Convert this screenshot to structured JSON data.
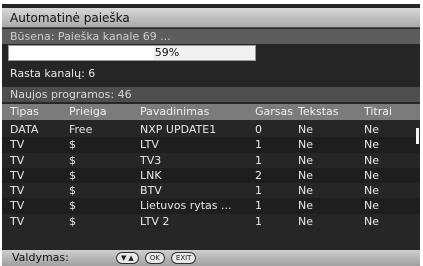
{
  "window": {
    "title": "Automatinė paieška"
  },
  "status": {
    "text": "Būsena: Paieška kanale 69 ..."
  },
  "progress": {
    "value": 0.59,
    "label": "59%"
  },
  "found": {
    "text": "Rasta kanalų: 6"
  },
  "new_programs": {
    "text": "Naujos programos: 46"
  },
  "table": {
    "columns": [
      "Tipas",
      "Prieiga",
      "Pavadinimas",
      "Garsas",
      "Tekstas",
      "Titrai"
    ],
    "rows": [
      [
        "DATA",
        "Free",
        "NXP UPDATE1",
        "0",
        "Ne",
        "Ne"
      ],
      [
        "TV",
        "$",
        "LTV",
        "1",
        "Ne",
        "Ne"
      ],
      [
        "TV",
        "$",
        "TV3",
        "1",
        "Ne",
        "Ne"
      ],
      [
        "TV",
        "$",
        "LNK",
        "2",
        "Ne",
        "Ne"
      ],
      [
        "TV",
        "$",
        "BTV",
        "1",
        "Ne",
        "Ne"
      ],
      [
        "TV",
        "$",
        "Lietuvos rytas ...",
        "1",
        "Ne",
        "Ne"
      ],
      [
        "TV",
        "$",
        "LTV 2",
        "1",
        "Ne",
        "Ne"
      ]
    ]
  },
  "footer": {
    "control_label": "Valdymas:",
    "keys": {
      "ok": "OK",
      "exit": "EXIT"
    },
    "icons": [
      "arrow-down-icon",
      "arrow-up-icon"
    ]
  },
  "colors": {
    "screen_bg": "#262626",
    "title_bar": "#c0c0c0",
    "header_bg": "#7b7b7b"
  }
}
